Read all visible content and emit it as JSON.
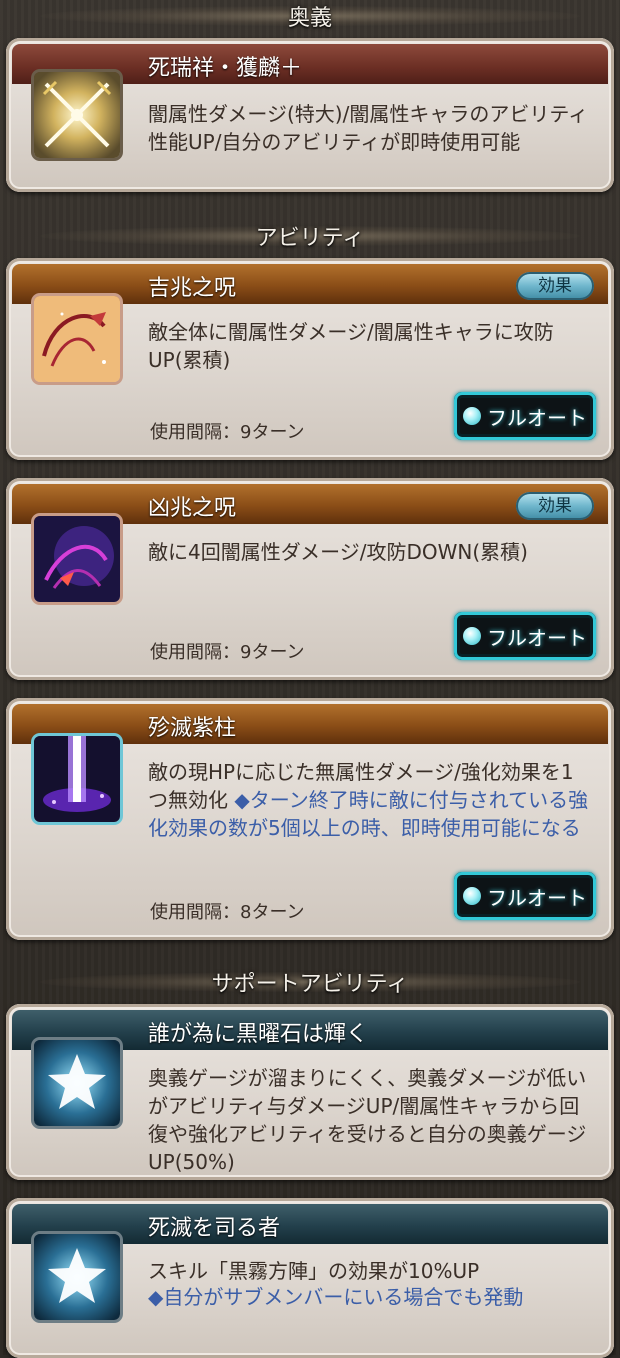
{
  "sections": {
    "ougi": "奥義",
    "ability": "アビリティ",
    "support": "サポートアビリティ"
  },
  "ougi": {
    "title": "死瑞祥・獲麟＋",
    "desc": "闇属性ダメージ(特大)/闇属性キャラのアビリティ性能UP/自分のアビリティが即時使用可能",
    "icon": "crossed-swords-icon"
  },
  "abilities": [
    {
      "title": "吉兆之呪",
      "desc": "敵全体に闇属性ダメージ/闇属性キャラに攻防UP(累積)",
      "interval": "使用間隔：9ターン",
      "effect_label": "効果",
      "auto_label": "フルオート",
      "icon": "red-ribbon-icon"
    },
    {
      "title": "凶兆之呪",
      "desc": "敵に4回闇属性ダメージ/攻防DOWN(累積)",
      "interval": "使用間隔：9ターン",
      "effect_label": "効果",
      "auto_label": "フルオート",
      "icon": "dark-ribbon-icon"
    },
    {
      "title": "殄滅紫柱",
      "desc": "敵の現HPに応じた無属性ダメージ/強化効果を1つ無効化",
      "note": "◆ターン終了時に敵に付与されている強化効果の数が5個以上の時、即時使用可能になる",
      "interval": "使用間隔：8ターン",
      "auto_label": "フルオート",
      "icon": "purple-pillar-icon"
    }
  ],
  "support": [
    {
      "title": "誰が為に黒曜石は輝く",
      "desc": "奥義ゲージが溜まりにくく、奥義ダメージが低いがアビリティ与ダメージUP/闇属性キャラから回復や強化アビリティを受けると自分の奥義ゲージUP(50%)",
      "icon": "star-icon"
    },
    {
      "title": "死滅を司る者",
      "desc": "スキル「黒霧方陣」の効果が10%UP",
      "note": "◆自分がサブメンバーにいる場合でも発動",
      "icon": "star-icon"
    }
  ],
  "colors": {
    "note_text": "#3b5ea8",
    "auto_button_glow": "#33c9d8"
  }
}
